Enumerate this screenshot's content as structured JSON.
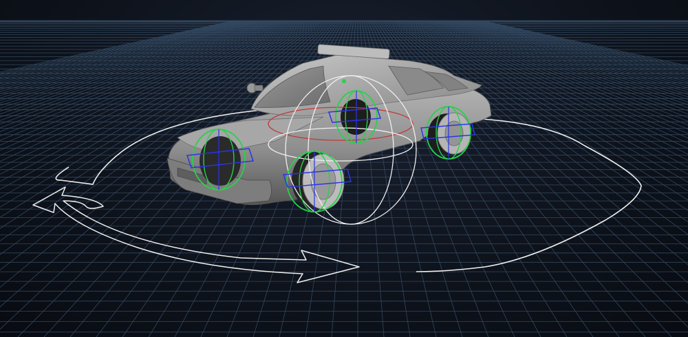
{
  "viewport": {
    "background": "#0e131c",
    "grid_color": "#4a6a88",
    "body_color": "#8a8a8a",
    "wheel_ring_color": "#27d24a",
    "wheel_axis_color": "#2a35e6",
    "rotate_ring_color": "#e8e8e8",
    "yaw_ring_color": "#c43838",
    "path_curve_color": "#f2f2f2"
  },
  "icons": {
    "direction_arrow": "curved-double-arrow-icon",
    "rotate_gizmo": "rotate-gizmo-icon"
  }
}
